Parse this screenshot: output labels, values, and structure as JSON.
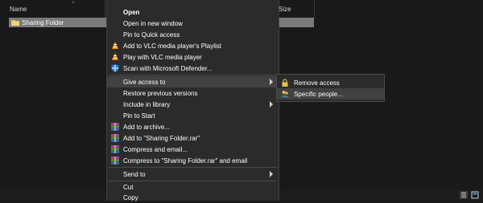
{
  "explorer": {
    "columns": {
      "name": "Name",
      "size": "Size"
    },
    "selected_item": "Sharing Folder"
  },
  "context_menu": {
    "items": [
      {
        "label": "Open"
      },
      {
        "label": "Open in new window"
      },
      {
        "label": "Pin to Quick access"
      },
      {
        "label": "Add to VLC media player's Playlist",
        "icon": "vlc-icon"
      },
      {
        "label": "Play with VLC media player",
        "icon": "vlc-icon"
      },
      {
        "label": "Scan with Microsoft Defender...",
        "icon": "defender-icon"
      },
      {
        "label": "Give access to",
        "has_submenu": true
      },
      {
        "label": "Restore previous versions"
      },
      {
        "label": "Include in library",
        "has_submenu": true
      },
      {
        "label": "Pin to Start"
      },
      {
        "label": "Add to archive...",
        "icon": "winrar-icon"
      },
      {
        "label": "Add to \"Sharing Folder.rar\"",
        "icon": "winrar-icon"
      },
      {
        "label": "Compress and email...",
        "icon": "winrar-icon"
      },
      {
        "label": "Compress to \"Sharing Folder.rar\" and email",
        "icon": "winrar-icon"
      },
      {
        "label": "Send to",
        "has_submenu": true
      },
      {
        "label": "Cut"
      },
      {
        "label": "Copy"
      }
    ]
  },
  "submenu": {
    "items": [
      {
        "label": "Remove access",
        "icon": "lock-icon"
      },
      {
        "label": "Specific people...",
        "icon": "people-icon"
      }
    ]
  },
  "colors": {
    "background": "#191919",
    "menu_background": "#2b2b2b",
    "highlight": "#414141",
    "selection": "#7a7a7a"
  }
}
